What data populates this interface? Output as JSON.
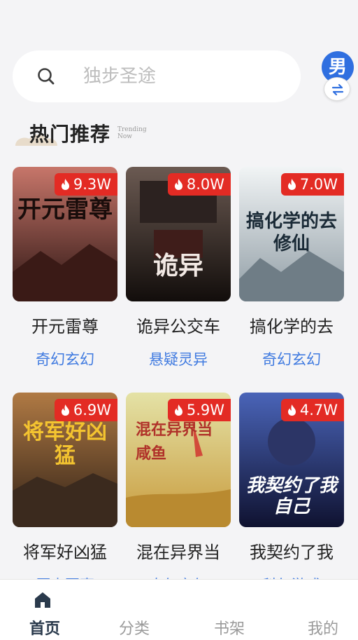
{
  "search": {
    "placeholder": "独步圣途"
  },
  "gender_toggle": {
    "label": "男"
  },
  "section": {
    "title": "热门推荐",
    "subtitle": "Trending Now"
  },
  "books": [
    {
      "title": "开元雷尊",
      "genre": "奇幻玄幻",
      "heat": "9.3W",
      "cover_text": "开元雷尊",
      "colors": [
        "#b85a4a",
        "#3a1d1a"
      ]
    },
    {
      "title": "诡异公交车",
      "genre": "悬疑灵异",
      "heat": "8.0W",
      "cover_text": "诡异",
      "colors": [
        "#5a4a45",
        "#1a1412"
      ]
    },
    {
      "title": "搞化学的去",
      "genre": "奇幻玄幻",
      "heat": "7.0W",
      "cover_text": "搞化学的去修仙",
      "colors": [
        "#e6ecef",
        "#9aa8b0"
      ]
    },
    {
      "title": "将军好凶猛",
      "genre": "历史军事",
      "heat": "6.9W",
      "cover_text": "将军好凶猛",
      "colors": [
        "#a36b3a",
        "#3e2a1c"
      ]
    },
    {
      "title": "混在异界当",
      "genre": "奇幻玄幻",
      "heat": "5.9W",
      "cover_text": "混在异界当咸鱼",
      "colors": [
        "#dcd88a",
        "#c9a24a"
      ]
    },
    {
      "title": "我契约了我",
      "genre": "科幻游戏",
      "heat": "4.7W",
      "cover_text": "我契约了我自己",
      "colors": [
        "#3b4fa0",
        "#12163a"
      ]
    }
  ],
  "tabs": [
    {
      "label": "首页",
      "active": true
    },
    {
      "label": "分类",
      "active": false
    },
    {
      "label": "书架",
      "active": false
    },
    {
      "label": "我的",
      "active": false
    }
  ],
  "colors": {
    "accent": "#3f7ae0",
    "badge": "#e32b24",
    "gender": "#2f6fe0"
  }
}
